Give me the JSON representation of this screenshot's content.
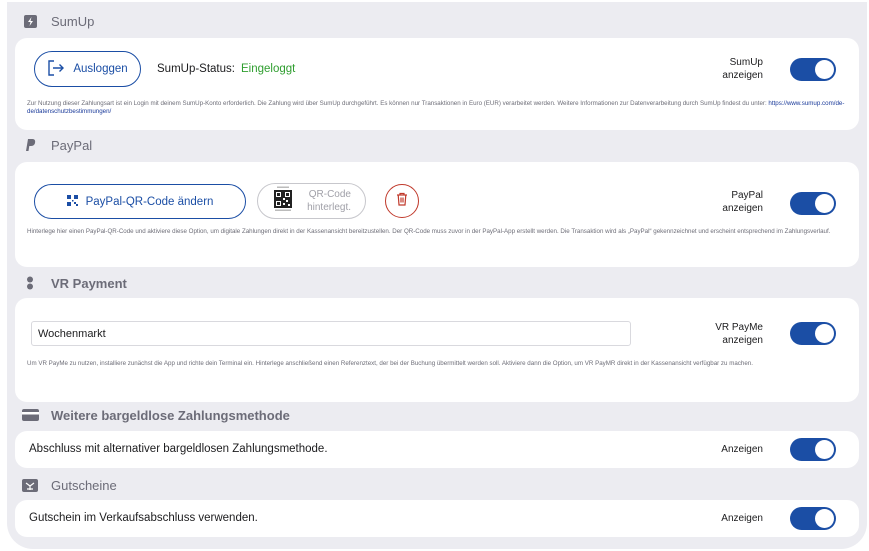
{
  "sumup": {
    "header": "SumUp",
    "logout_label": "Ausloggen",
    "status_label": "SumUp-Status:",
    "status_value": "Eingeloggt",
    "toggle_label_1": "SumUp",
    "toggle_label_2": "anzeigen",
    "note": "Zur Nutzung dieser Zahlungsart ist ein Login mit deinem SumUp-Konto erforderlich. Die Zahlung wird über SumUp durchgeführt. Es können nur Transaktionen in Euro (EUR) verarbeitet werden. Weitere Informationen zur Datenverarbeitung durch SumUp findest du unter: ",
    "note_link": "https://www.sumup.com/de-de/datenschutzbestimmungen/"
  },
  "paypal": {
    "header": "PayPal",
    "change_qr_label": "PayPal-QR-Code ändern",
    "qr_status_1": "QR-Code",
    "qr_status_2": "hinterlegt.",
    "toggle_label_1": "PayPal",
    "toggle_label_2": "anzeigen",
    "note": "Hinterlege hier einen PayPal-QR-Code und aktiviere diese Option, um digitale Zahlungen direkt in der Kassenansicht bereitzustellen. Der QR-Code muss zuvor in der PayPal-App erstellt werden. Die Transaktion wird als „PayPal“ gekennzeichnet und erscheint entsprechend im Zahlungsverlauf."
  },
  "vrpayment": {
    "header": "VR Payment",
    "reference_value": "Wochenmarkt",
    "toggle_label_1": "VR PayMe",
    "toggle_label_2": "anzeigen",
    "note": "Um VR PayMe zu nutzen, installiere zunächst die App und richte dein Terminal ein. Hinterlege anschließend einen Referenztext, der bei der Buchung übermittelt werden soll. Aktiviere dann die Option, um VR PayMR direkt in der Kassenansicht verfügbar zu machen."
  },
  "other_cashless": {
    "header": "Weitere bargeldlose Zahlungsmethode",
    "row_text": "Abschluss mit alternativer bargeldlosen Zahlungsmethode.",
    "toggle_label": "Anzeigen"
  },
  "vouchers": {
    "header": "Gutscheine",
    "row_text": "Gutschein im Verkaufsabschluss verwenden.",
    "toggle_label": "Anzeigen"
  },
  "colors": {
    "accent": "#1b4ea5",
    "success": "#2f9e2f",
    "danger": "#c0392b",
    "background": "#ececf1"
  },
  "toggles": {
    "sumup": true,
    "paypal": true,
    "vrpayme": true,
    "other_cashless": true,
    "vouchers": true
  }
}
